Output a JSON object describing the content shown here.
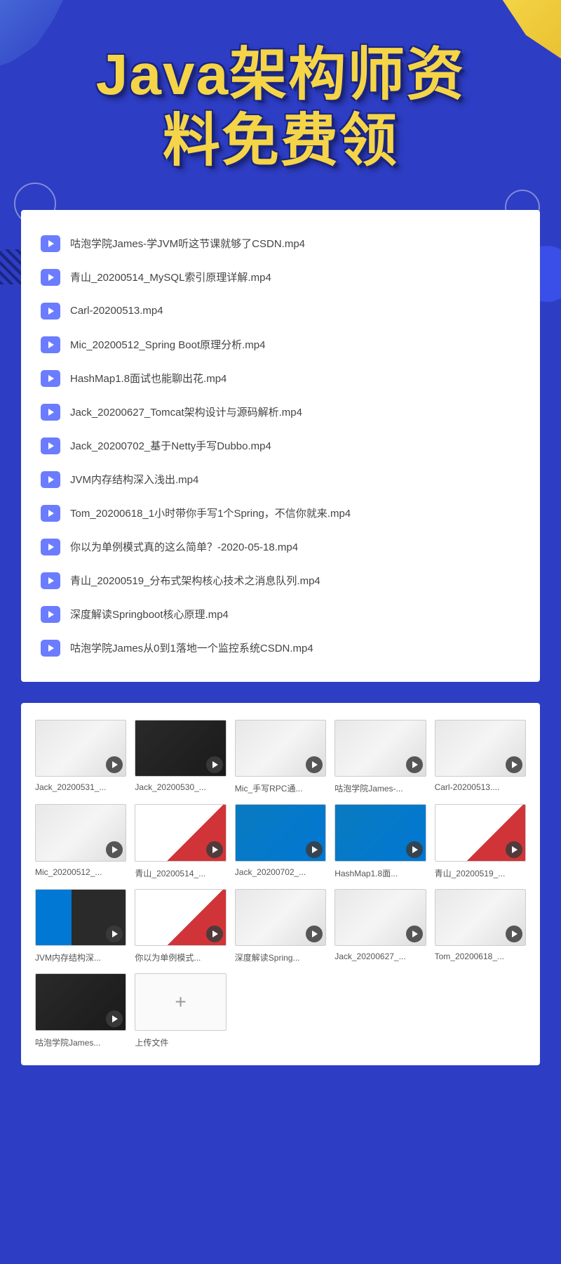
{
  "hero": {
    "title_line1": "Java架构师资",
    "title_line2": "料免费领"
  },
  "file_list": [
    {
      "name": "咕泡学院James-学JVM听这节课就够了CSDN.mp4"
    },
    {
      "name": "青山_20200514_MySQL索引原理详解.mp4"
    },
    {
      "name": "Carl-20200513.mp4"
    },
    {
      "name": "Mic_20200512_Spring Boot原理分析.mp4"
    },
    {
      "name": "HashMap1.8面试也能聊出花.mp4"
    },
    {
      "name": "Jack_20200627_Tomcat架构设计与源码解析.mp4"
    },
    {
      "name": "Jack_20200702_基于Netty手写Dubbo.mp4"
    },
    {
      "name": "JVM内存结构深入浅出.mp4"
    },
    {
      "name": "Tom_20200618_1小时带你手写1个Spring，不信你就来.mp4"
    },
    {
      "name": "你以为单例模式真的这么简单？-2020-05-18.mp4"
    },
    {
      "name": "青山_20200519_分布式架构核心技术之消息队列.mp4"
    },
    {
      "name": "深度解读Springboot核心原理.mp4"
    },
    {
      "name": "咕泡学院James从0到1落地一个监控系统CSDN.mp4"
    }
  ],
  "thumbnails": [
    {
      "label": "Jack_20200531_...",
      "style": "light"
    },
    {
      "label": "Jack_20200530_...",
      "style": "dark"
    },
    {
      "label": "Mic_手写RPC通...",
      "style": "light"
    },
    {
      "label": "咕泡学院James-...",
      "style": "light"
    },
    {
      "label": "Carl-20200513....",
      "style": "light"
    },
    {
      "label": "Mic_20200512_...",
      "style": "light"
    },
    {
      "label": "青山_20200514_...",
      "style": "red-accent"
    },
    {
      "label": "Jack_20200702_...",
      "style": "desktop"
    },
    {
      "label": "HashMap1.8面...",
      "style": "desktop"
    },
    {
      "label": "青山_20200519_...",
      "style": "red-accent"
    },
    {
      "label": "JVM内存结构深...",
      "style": "split"
    },
    {
      "label": "你以为单例模式...",
      "style": "red-accent"
    },
    {
      "label": "深度解读Spring...",
      "style": "light"
    },
    {
      "label": "Jack_20200627_...",
      "style": "light"
    },
    {
      "label": "Tom_20200618_...",
      "style": "light"
    },
    {
      "label": "咕泡学院James...",
      "style": "dark"
    }
  ],
  "upload": {
    "label": "上传文件",
    "icon": "+"
  }
}
